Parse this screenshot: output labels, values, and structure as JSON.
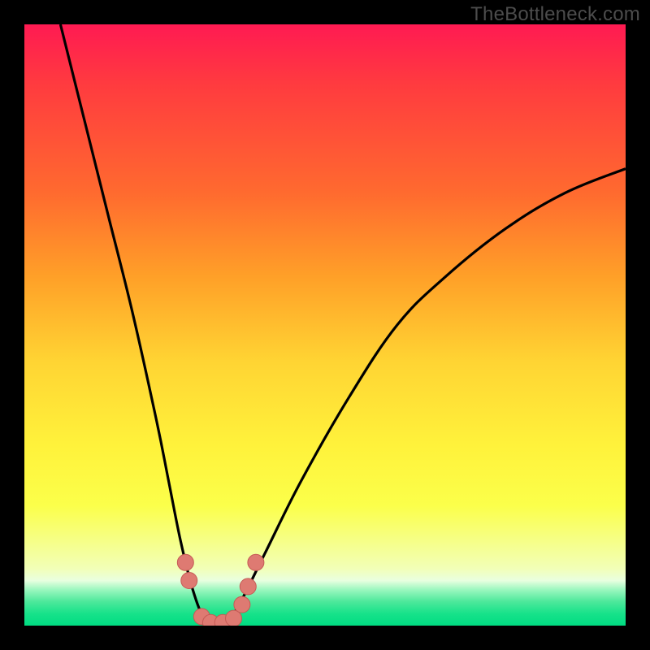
{
  "attribution": "TheBottleneck.com",
  "colors": {
    "frame": "#000000",
    "gradient_top": "#ff1a52",
    "gradient_bottom": "#00dc82",
    "curve": "#000000",
    "markers_fill": "#de7a72",
    "markers_stroke": "#c55a55"
  },
  "chart_data": {
    "type": "line",
    "title": "",
    "xlabel": "",
    "ylabel": "",
    "xlim": [
      0,
      100
    ],
    "ylim": [
      0,
      100
    ],
    "note": "No axes, ticks, or numeric labels are rendered; values are estimated positions in a 0–100 plot-area coordinate system (y=0 at bottom, y=100 at top).",
    "series": [
      {
        "name": "bottleneck-curve",
        "x": [
          6,
          10,
          14,
          18,
          22,
          24,
          26,
          28,
          30,
          32,
          34,
          36,
          40,
          46,
          54,
          62,
          70,
          80,
          90,
          100
        ],
        "y": [
          100,
          84,
          68,
          52,
          34,
          24,
          14,
          6,
          1,
          0,
          1,
          4,
          12,
          24,
          38,
          50,
          58,
          66,
          72,
          76
        ]
      }
    ],
    "markers": [
      {
        "x": 26.8,
        "y": 10.5
      },
      {
        "x": 27.4,
        "y": 7.5
      },
      {
        "x": 29.5,
        "y": 1.5
      },
      {
        "x": 31.0,
        "y": 0.5
      },
      {
        "x": 33.0,
        "y": 0.5
      },
      {
        "x": 34.8,
        "y": 1.2
      },
      {
        "x": 36.2,
        "y": 3.5
      },
      {
        "x": 37.2,
        "y": 6.5
      },
      {
        "x": 38.5,
        "y": 10.5
      }
    ]
  }
}
